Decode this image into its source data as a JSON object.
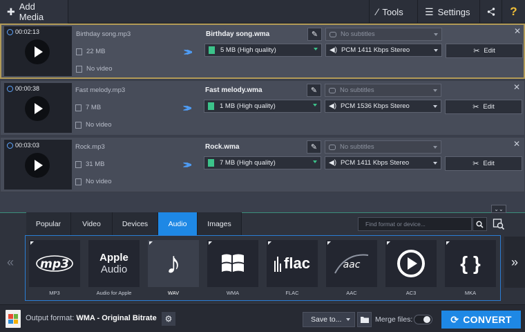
{
  "toolbar": {
    "add_media": "Add Media",
    "tools": "Tools",
    "settings": "Settings"
  },
  "files": [
    {
      "duration": "00:02:13",
      "source_name": "Birthday song.mp3",
      "source_size": "22 MB",
      "video": "No video",
      "output_name": "Birthday song.wma",
      "quality": "5 MB (High quality)",
      "subtitles": "No subtitles",
      "audio": "PCM 1411 Kbps Stereo",
      "edit": "Edit",
      "selected": true
    },
    {
      "duration": "00:00:38",
      "source_name": "Fast melody.mp3",
      "source_size": "7 MB",
      "video": "No video",
      "output_name": "Fast melody.wma",
      "quality": "1 MB (High quality)",
      "subtitles": "No subtitles",
      "audio": "PCM 1536 Kbps Stereo",
      "edit": "Edit",
      "selected": false
    },
    {
      "duration": "00:03:03",
      "source_name": "Rock.mp3",
      "source_size": "31 MB",
      "video": "No video",
      "output_name": "Rock.wma",
      "quality": "7 MB (High quality)",
      "subtitles": "No subtitles",
      "audio": "PCM 1411 Kbps Stereo",
      "edit": "Edit",
      "selected": false
    }
  ],
  "format_tabs": [
    {
      "label": "Popular",
      "active": false
    },
    {
      "label": "Video",
      "active": false
    },
    {
      "label": "Devices",
      "active": false
    },
    {
      "label": "Audio",
      "active": true
    },
    {
      "label": "Images",
      "active": false
    }
  ],
  "search": {
    "placeholder": "Find format or device..."
  },
  "formats": [
    {
      "logo": "mp3",
      "label": "MP3",
      "active": false
    },
    {
      "logo_line1": "Apple",
      "logo_line2": "Audio",
      "label": "Audio for Apple",
      "active": false
    },
    {
      "logo": "♪",
      "label": "WAV",
      "active": true
    },
    {
      "logo": "windows",
      "label": "WMA",
      "active": false
    },
    {
      "logo": "flac",
      "label": "FLAC",
      "active": false
    },
    {
      "logo": "aac",
      "label": "AAC",
      "active": false
    },
    {
      "logo": "play",
      "label": "AC3",
      "active": false
    },
    {
      "logo": "{ }",
      "label": "MKA",
      "active": false
    }
  ],
  "footer": {
    "output_prefix": "Output format:",
    "output_format": "WMA - Original Bitrate",
    "save_to": "Save to...",
    "merge_files": "Merge files:",
    "convert": "CONVERT"
  },
  "colors": {
    "accent": "#1e88e5",
    "selection_border": "#b39b57",
    "quality_green": "#3cc38a",
    "help_yellow": "#f2c037"
  },
  "icons": {
    "add": "plus-icon",
    "tools": "magic-wand-icon",
    "settings": "menu-icon",
    "share": "share-icon",
    "help": "question-icon"
  }
}
